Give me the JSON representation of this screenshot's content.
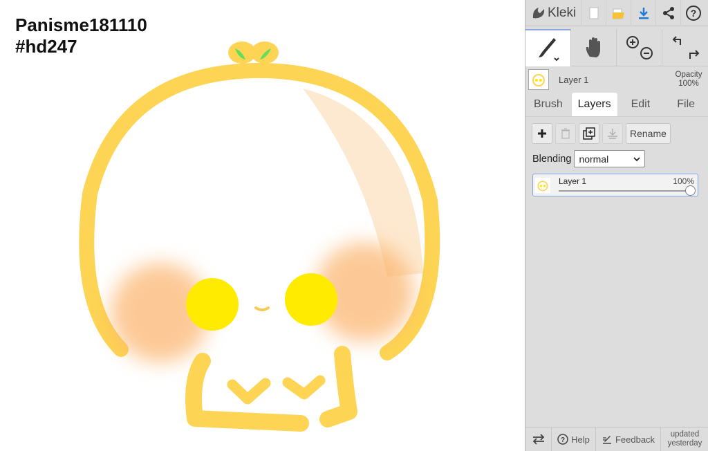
{
  "canvas": {
    "text_line1": "Panisme181110",
    "text_line2": "#hd247",
    "colors": {
      "outline": "#fdd453",
      "cheek_blush": "#fbb36a",
      "eye": "#ffeb00",
      "sprout_leaf": "#5ee05a",
      "highlight": "#fde4c4"
    }
  },
  "topbar": {
    "app_name": "Kleki",
    "icons": [
      "kleki-logo-icon",
      "new-image-icon",
      "open-folder-icon",
      "download-icon",
      "share-icon",
      "help-icon"
    ]
  },
  "tools": {
    "brush_tool_icon": "brush-icon",
    "hand_tool_icon": "hand-icon",
    "zoom_icons": [
      "zoom-in-icon",
      "zoom-out-icon"
    ],
    "history_icons": [
      "undo-icon",
      "redo-icon"
    ]
  },
  "current_layer": {
    "name": "Layer 1",
    "opacity_label": "Opacity",
    "opacity_value": "100%"
  },
  "tabs": [
    {
      "label": "Brush"
    },
    {
      "label": "Layers"
    },
    {
      "label": "Edit"
    },
    {
      "label": "File"
    }
  ],
  "layers_panel": {
    "rename_label": "Rename",
    "blending_label": "Blending",
    "blending_value": "normal",
    "layers": [
      {
        "name": "Layer 1",
        "opacity_text": "100%",
        "opacity": 1.0
      }
    ]
  },
  "bottom": {
    "help_label": "Help",
    "feedback_label": "Feedback",
    "updated_line1": "updated",
    "updated_line2": "yesterday"
  }
}
